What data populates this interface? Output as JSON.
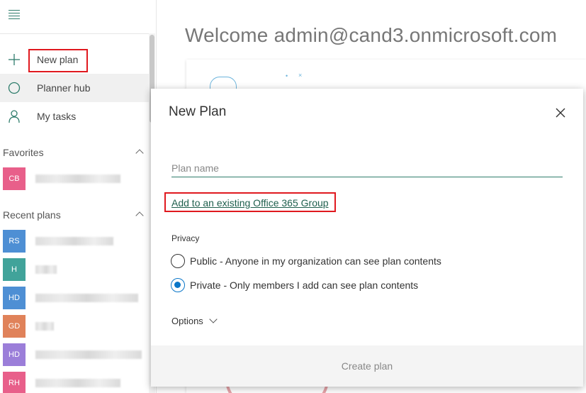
{
  "sidebar": {
    "nav": [
      {
        "label": "New plan",
        "icon": "plus-icon"
      },
      {
        "label": "Planner hub",
        "icon": "hub-circle-icon"
      },
      {
        "label": "My tasks",
        "icon": "person-icon"
      }
    ],
    "favorites": {
      "title": "Favorites",
      "items": [
        {
          "initials": "CB",
          "color": "#e85f8a"
        }
      ]
    },
    "recent": {
      "title": "Recent plans",
      "items": [
        {
          "initials": "RS",
          "color": "#4e8fd4"
        },
        {
          "initials": "H",
          "color": "#41a39a"
        },
        {
          "initials": "HD",
          "color": "#4e8fd4"
        },
        {
          "initials": "GD",
          "color": "#e0825a"
        },
        {
          "initials": "HD",
          "color": "#9b7ed9"
        },
        {
          "initials": "RH",
          "color": "#e85f8a"
        }
      ]
    }
  },
  "main": {
    "welcome": "Welcome admin@cand3.onmicrosoft.com"
  },
  "dialog": {
    "title": "New Plan",
    "name_placeholder": "Plan name",
    "group_link": "Add to an existing Office 365 Group",
    "privacy_label": "Privacy",
    "radio_public": "Public - Anyone in my organization can see plan contents",
    "radio_private": "Private - Only members I add can see plan contents",
    "options_label": "Options",
    "create_button": "Create plan"
  },
  "colors": {
    "accent": "#2f7d6c",
    "radio_selected": "#0a76c8",
    "highlight": "#e0191f"
  }
}
